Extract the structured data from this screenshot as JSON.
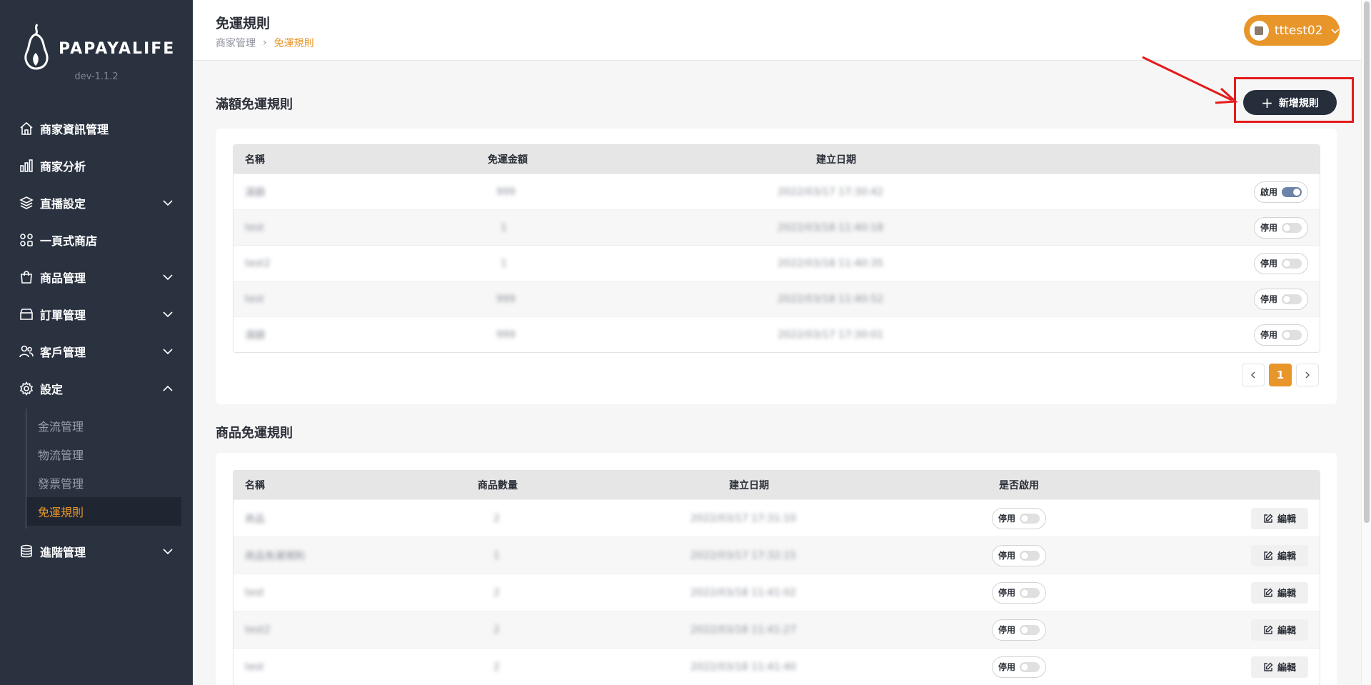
{
  "brand": {
    "name": "PAPAYALIFE",
    "version": "dev-1.1.2"
  },
  "sidebar": {
    "items": [
      {
        "label": "商家資訊管理",
        "icon": "home-icon"
      },
      {
        "label": "商家分析",
        "icon": "bar-chart-icon"
      },
      {
        "label": "直播設定",
        "icon": "layers-icon"
      },
      {
        "label": "一頁式商店",
        "icon": "grid-icon"
      },
      {
        "label": "商品管理",
        "icon": "shopping-bag-icon"
      },
      {
        "label": "訂單管理",
        "icon": "box-icon"
      },
      {
        "label": "客戶管理",
        "icon": "users-icon"
      },
      {
        "label": "設定",
        "icon": "gear-icon"
      },
      {
        "label": "進階管理",
        "icon": "database-icon"
      }
    ],
    "settings_sub": [
      "金流管理",
      "物流管理",
      "發票管理",
      "免運規則"
    ]
  },
  "header": {
    "title": "免運規則",
    "breadcrumb": [
      "商家管理",
      "免運規則"
    ],
    "user": "tttest02"
  },
  "amount_rules": {
    "title": "滿額免運規則",
    "add_button": "新增規則",
    "columns": [
      "名稱",
      "免運金額",
      "建立日期"
    ],
    "rows": [
      {
        "name": "滿額",
        "amount": "999",
        "date": "2022/03/17 17:30:42",
        "status": "啟用",
        "on": true
      },
      {
        "name": "test",
        "amount": "1",
        "date": "2022/03/18 11:40:18",
        "status": "停用",
        "on": false
      },
      {
        "name": "test2",
        "amount": "1",
        "date": "2022/03/18 11:40:35",
        "status": "停用",
        "on": false
      },
      {
        "name": "test",
        "amount": "999",
        "date": "2022/03/18 11:40:52",
        "status": "停用",
        "on": false
      },
      {
        "name": "滿額",
        "amount": "999",
        "date": "2022/03/17 17:30:01",
        "status": "停用",
        "on": false
      }
    ],
    "page": "1"
  },
  "product_rules": {
    "title": "商品免運規則",
    "columns": [
      "名稱",
      "商品數量",
      "建立日期",
      "是否啟用"
    ],
    "edit_label": "編輯",
    "rows": [
      {
        "name": "商品",
        "qty": "2",
        "date": "2022/03/17 17:31:10",
        "status": "停用"
      },
      {
        "name": "商品免運規則",
        "qty": "1",
        "date": "2022/03/17 17:32:15",
        "status": "停用"
      },
      {
        "name": "test",
        "qty": "2",
        "date": "2022/03/18 11:41:02",
        "status": "停用"
      },
      {
        "name": "test2",
        "qty": "2",
        "date": "2022/03/18 11:41:27",
        "status": "停用"
      },
      {
        "name": "test",
        "qty": "2",
        "date": "2022/03/18 11:41:40",
        "status": "停用"
      }
    ]
  },
  "colors": {
    "accent": "#e8952a",
    "sidebar": "#2a3240",
    "highlight": "#e31b1b"
  }
}
